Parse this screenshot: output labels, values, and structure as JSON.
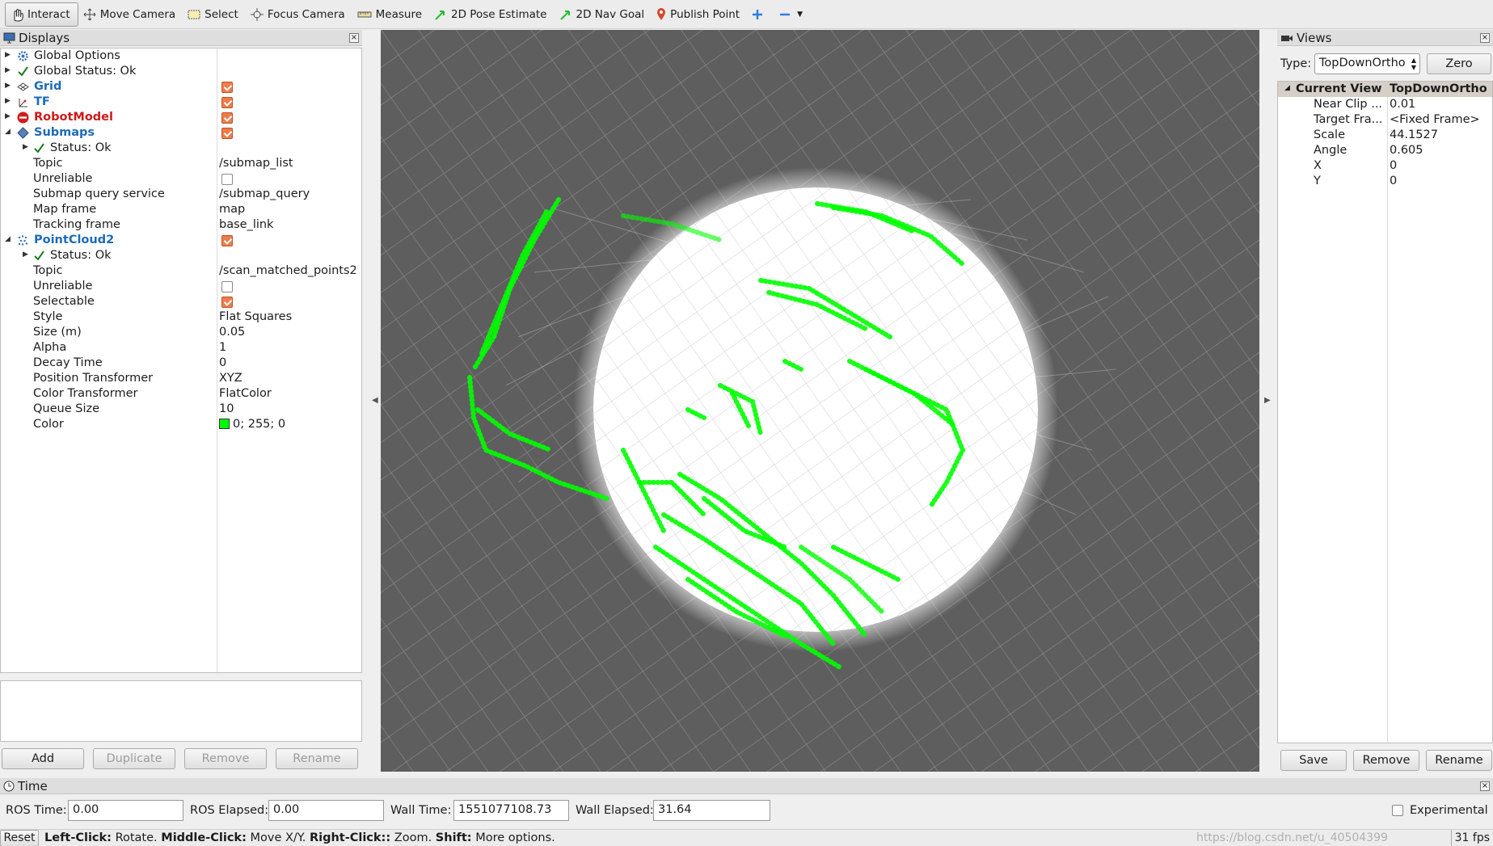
{
  "toolbar": {
    "interact": "Interact",
    "move_camera": "Move Camera",
    "select": "Select",
    "focus_camera": "Focus Camera",
    "measure": "Measure",
    "pose_estimate": "2D Pose Estimate",
    "nav_goal": "2D Nav Goal",
    "publish_point": "Publish Point"
  },
  "displays": {
    "title": "Displays",
    "global_options": "Global Options",
    "global_status": "Global Status: Ok",
    "grid": "Grid",
    "tf": "TF",
    "robot_model": "RobotModel",
    "submaps": {
      "label": "Submaps",
      "status": "Status: Ok",
      "props": [
        {
          "k": "Topic",
          "v": "/submap_list"
        },
        {
          "k": "Unreliable",
          "v": ""
        },
        {
          "k": "Submap query service",
          "v": "/submap_query"
        },
        {
          "k": "Map frame",
          "v": "map"
        },
        {
          "k": "Tracking frame",
          "v": "base_link"
        }
      ]
    },
    "pointcloud": {
      "label": "PointCloud2",
      "status": "Status: Ok",
      "props": [
        {
          "k": "Topic",
          "v": "/scan_matched_points2"
        },
        {
          "k": "Unreliable",
          "v": ""
        },
        {
          "k": "Selectable",
          "v": ""
        },
        {
          "k": "Style",
          "v": "Flat Squares"
        },
        {
          "k": "Size (m)",
          "v": "0.05"
        },
        {
          "k": "Alpha",
          "v": "1"
        },
        {
          "k": "Decay Time",
          "v": "0"
        },
        {
          "k": "Position Transformer",
          "v": "XYZ"
        },
        {
          "k": "Color Transformer",
          "v": "FlatColor"
        },
        {
          "k": "Queue Size",
          "v": "10"
        },
        {
          "k": "Color",
          "v": "0; 255; 0"
        }
      ]
    },
    "buttons": {
      "add": "Add",
      "duplicate": "Duplicate",
      "remove": "Remove",
      "rename": "Rename"
    }
  },
  "views": {
    "title": "Views",
    "type_label": "Type:",
    "type_value": "TopDownOrtho",
    "zero": "Zero",
    "current_view": "Current View",
    "current_view_value": "TopDownOrtho ...",
    "props": [
      {
        "k": "Near Clip ...",
        "v": "0.01"
      },
      {
        "k": "Target Fra...",
        "v": "<Fixed Frame>"
      },
      {
        "k": "Scale",
        "v": "44.1527"
      },
      {
        "k": "Angle",
        "v": "0.605"
      },
      {
        "k": "X",
        "v": "0"
      },
      {
        "k": "Y",
        "v": "0"
      }
    ],
    "buttons": {
      "save": "Save",
      "remove": "Remove",
      "rename": "Rename"
    }
  },
  "time": {
    "title": "Time",
    "ros_time_label": "ROS Time:",
    "ros_time": "0.00",
    "ros_elapsed_label": "ROS Elapsed:",
    "ros_elapsed": "0.00",
    "wall_time_label": "Wall Time:",
    "wall_time": "1551077108.73",
    "wall_elapsed_label": "Wall Elapsed:",
    "wall_elapsed": "31.64",
    "experimental": "Experimental"
  },
  "status": {
    "reset": "Reset",
    "left_click": "Left-Click:",
    "left_click_action": "Rotate.",
    "middle_click": "Middle-Click:",
    "middle_click_action": "Move X/Y.",
    "right_click": "Right-Click::",
    "right_click_action": "Zoom.",
    "shift": "Shift:",
    "shift_action": "More options.",
    "fps": "31 fps",
    "watermark": "https://blog.csdn.net/u_40504399"
  },
  "colors": {
    "point_cloud": "#00ff00",
    "viewport_bg": "#5e5e5e",
    "checkbox_on": "#f07c4a"
  }
}
